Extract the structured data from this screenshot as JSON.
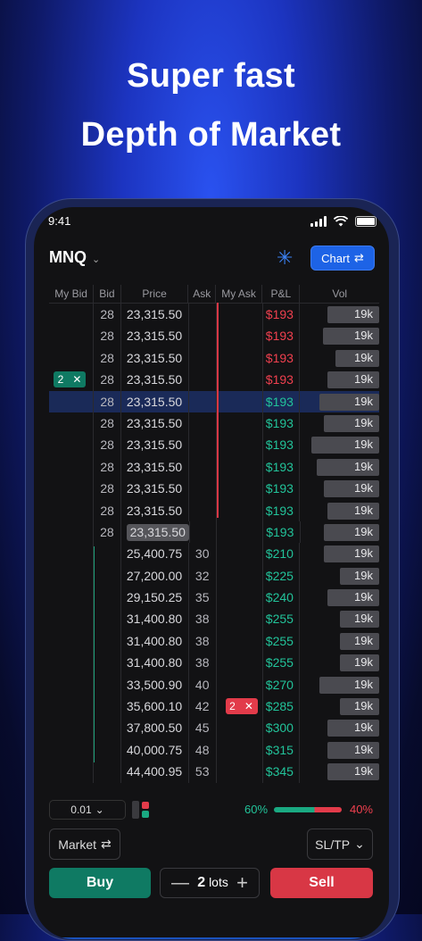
{
  "headline": {
    "line1": "Super fast",
    "line2": "Depth of Market"
  },
  "status": {
    "time": "9:41"
  },
  "topbar": {
    "symbol": "MNQ",
    "chart_label": "Chart"
  },
  "columns": [
    "My Bid",
    "Bid",
    "Price",
    "Ask",
    "My Ask",
    "P&L",
    "Vol"
  ],
  "rows": [
    {
      "bid": "28",
      "price": "23,315.50",
      "ask": "",
      "pnl": "$193",
      "pnl_sign": "neg",
      "vol": "19k",
      "vol_level": 0.66
    },
    {
      "bid": "28",
      "price": "23,315.50",
      "ask": "",
      "pnl": "$193",
      "pnl_sign": "neg",
      "vol": "19k",
      "vol_level": 0.72
    },
    {
      "bid": "28",
      "price": "23,315.50",
      "ask": "",
      "pnl": "$193",
      "pnl_sign": "neg",
      "vol": "19k",
      "vol_level": 0.56
    },
    {
      "bid": "28",
      "price": "23,315.50",
      "ask": "",
      "pnl": "$193",
      "pnl_sign": "neg",
      "vol": "19k",
      "vol_level": 0.66,
      "my_bid": "2"
    },
    {
      "bid": "28",
      "price": "23,315.50",
      "ask": "",
      "pnl": "$193",
      "pnl_sign": "pos",
      "vol": "19k",
      "vol_level": 0.76,
      "highlight": true
    },
    {
      "bid": "28",
      "price": "23,315.50",
      "ask": "",
      "pnl": "$193",
      "pnl_sign": "pos",
      "vol": "19k",
      "vol_level": 0.7
    },
    {
      "bid": "28",
      "price": "23,315.50",
      "ask": "",
      "pnl": "$193",
      "pnl_sign": "pos",
      "vol": "19k",
      "vol_level": 0.86
    },
    {
      "bid": "28",
      "price": "23,315.50",
      "ask": "",
      "pnl": "$193",
      "pnl_sign": "pos",
      "vol": "19k",
      "vol_level": 0.8
    },
    {
      "bid": "28",
      "price": "23,315.50",
      "ask": "",
      "pnl": "$193",
      "pnl_sign": "pos",
      "vol": "19k",
      "vol_level": 0.7
    },
    {
      "bid": "28",
      "price": "23,315.50",
      "ask": "",
      "pnl": "$193",
      "pnl_sign": "pos",
      "vol": "19k",
      "vol_level": 0.66
    },
    {
      "bid": "28",
      "price": "23,315.50",
      "ask": "",
      "pnl": "$193",
      "pnl_sign": "pos",
      "vol": "19k",
      "vol_level": 0.7,
      "price_boxed": true
    },
    {
      "bid": "",
      "price": "25,400.75",
      "ask": "30",
      "pnl": "$210",
      "pnl_sign": "pos",
      "vol": "19k",
      "vol_level": 0.7
    },
    {
      "bid": "",
      "price": "27,200.00",
      "ask": "32",
      "pnl": "$225",
      "pnl_sign": "pos",
      "vol": "19k",
      "vol_level": 0.5
    },
    {
      "bid": "",
      "price": "29,150.25",
      "ask": "35",
      "pnl": "$240",
      "pnl_sign": "pos",
      "vol": "19k",
      "vol_level": 0.66
    },
    {
      "bid": "",
      "price": "31,400.80",
      "ask": "38",
      "pnl": "$255",
      "pnl_sign": "pos",
      "vol": "19k",
      "vol_level": 0.5
    },
    {
      "bid": "",
      "price": "31,400.80",
      "ask": "38",
      "pnl": "$255",
      "pnl_sign": "pos",
      "vol": "19k",
      "vol_level": 0.5
    },
    {
      "bid": "",
      "price": "31,400.80",
      "ask": "38",
      "pnl": "$255",
      "pnl_sign": "pos",
      "vol": "19k",
      "vol_level": 0.5
    },
    {
      "bid": "",
      "price": "33,500.90",
      "ask": "40",
      "pnl": "$270",
      "pnl_sign": "pos",
      "vol": "19k",
      "vol_level": 0.76
    },
    {
      "bid": "",
      "price": "35,600.10",
      "ask": "42",
      "pnl": "$285",
      "pnl_sign": "pos",
      "vol": "19k",
      "vol_level": 0.5,
      "my_ask": "2"
    },
    {
      "bid": "",
      "price": "37,800.50",
      "ask": "45",
      "pnl": "$300",
      "pnl_sign": "pos",
      "vol": "19k",
      "vol_level": 0.66
    },
    {
      "bid": "",
      "price": "40,000.75",
      "ask": "48",
      "pnl": "$315",
      "pnl_sign": "pos",
      "vol": "19k",
      "vol_level": 0.66
    },
    {
      "bid": "",
      "price": "44,400.95",
      "ask": "53",
      "pnl": "$345",
      "pnl_sign": "pos",
      "vol": "19k",
      "vol_level": 0.66
    }
  ],
  "bottom": {
    "step_value": "0.01",
    "buy_pct": "60%",
    "sell_pct": "40%",
    "buy_ratio": 0.6,
    "order_type": "Market",
    "sltp": "SL/TP",
    "buy_label": "Buy",
    "sell_label": "Sell",
    "lots_value": "2",
    "lots_unit": "lots"
  },
  "colors": {
    "accent": "#1d63e6",
    "buy": "#0f7a63",
    "sell": "#d83745",
    "positive": "#22c39a",
    "negative": "#f0404f"
  }
}
